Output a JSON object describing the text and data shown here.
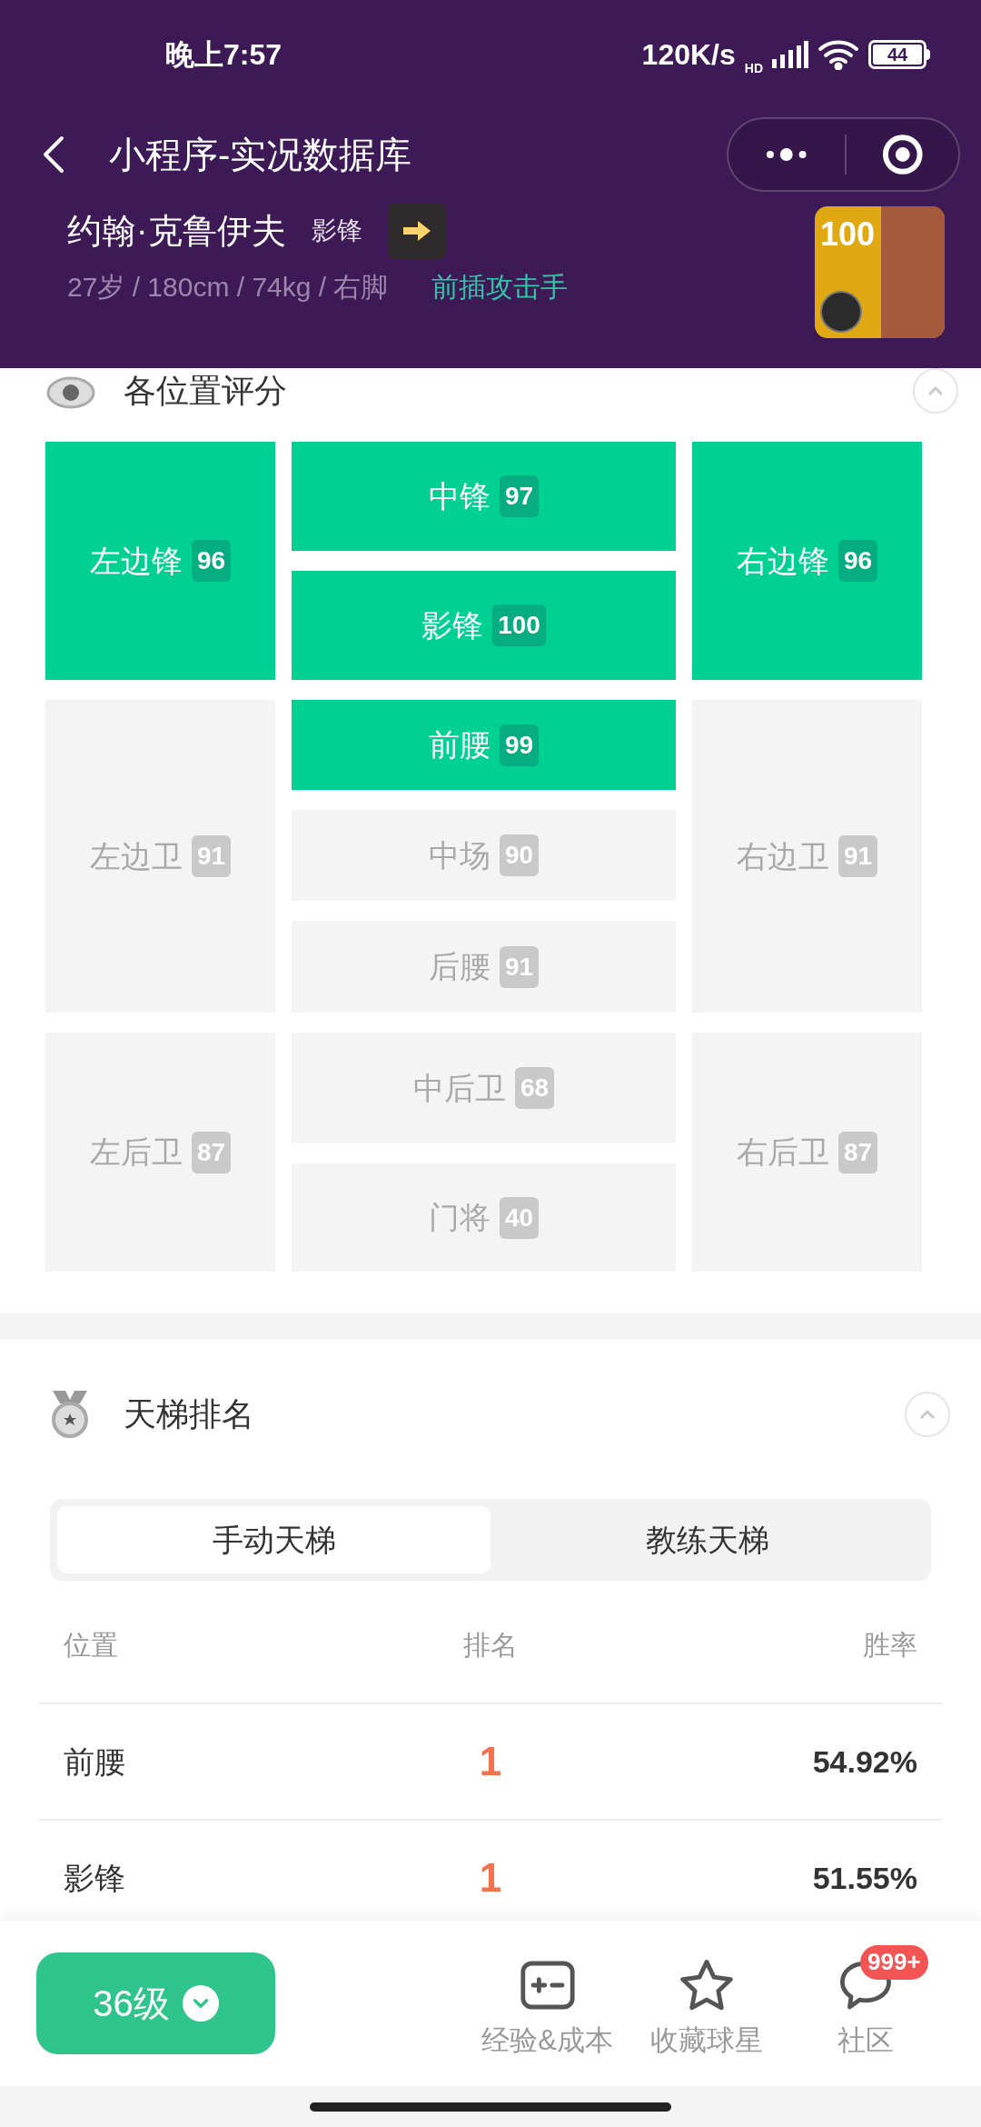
{
  "status_bar": {
    "time": "晚上7:57",
    "net_speed": "120K/s",
    "signal_tag": "HD",
    "battery": "44"
  },
  "nav": {
    "title": "小程序-实况数据库"
  },
  "player": {
    "name": "约翰·克鲁伊夫",
    "position": "影锋",
    "info": "27岁 / 180cm / 74kg / 右脚",
    "style": "前插攻击手",
    "card_rating": "100"
  },
  "position_section": {
    "title": "各位置评分",
    "expanded": true,
    "left_column": [
      {
        "label": "左边锋",
        "score": "96",
        "suitable": true
      },
      {
        "label": "左边卫",
        "score": "91",
        "suitable": false
      },
      {
        "label": "左后卫",
        "score": "87",
        "suitable": false
      }
    ],
    "center_column": [
      {
        "label": "中锋",
        "score": "97",
        "suitable": true
      },
      {
        "label": "影锋",
        "score": "100",
        "suitable": true
      },
      {
        "label": "前腰",
        "score": "99",
        "suitable": true
      },
      {
        "label": "中场",
        "score": "90",
        "suitable": false
      },
      {
        "label": "后腰",
        "score": "91",
        "suitable": false
      },
      {
        "label": "中后卫",
        "score": "68",
        "suitable": false
      },
      {
        "label": "门将",
        "score": "40",
        "suitable": false
      }
    ],
    "right_column": [
      {
        "label": "右边锋",
        "score": "96",
        "suitable": true
      },
      {
        "label": "右边卫",
        "score": "91",
        "suitable": false
      },
      {
        "label": "右后卫",
        "score": "87",
        "suitable": false
      }
    ]
  },
  "ladder_section": {
    "title": "天梯排名",
    "expanded": true,
    "tabs": [
      {
        "label": "手动天梯",
        "selected": true
      },
      {
        "label": "教练天梯",
        "selected": false
      }
    ],
    "columns": [
      "位置",
      "排名",
      "胜率"
    ],
    "rows": [
      {
        "position": "前腰",
        "rank": "1",
        "win_rate": "54.92%"
      },
      {
        "position": "影锋",
        "rank": "1",
        "win_rate": "51.55%"
      }
    ]
  },
  "bottom_bar": {
    "level_button": "36级",
    "actions": [
      {
        "kind": "calculator",
        "label": "经验&成本"
      },
      {
        "kind": "star",
        "label": "收藏球星"
      },
      {
        "kind": "chat",
        "label": "社区",
        "badge": "999+"
      }
    ]
  }
}
